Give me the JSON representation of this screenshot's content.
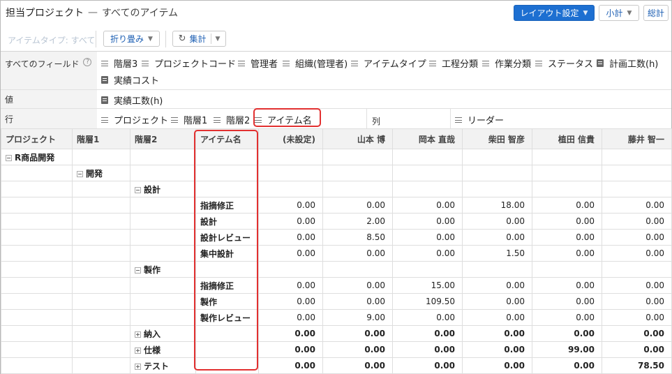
{
  "header": {
    "title": "担当プロジェクト",
    "separator": "—",
    "subtitle": "すべてのアイテム",
    "layout_button": "レイアウト設定",
    "subtotal_button": "小計",
    "total_button": "総計"
  },
  "toolbar": {
    "item_type_filter": "アイテムタイプ: すべて",
    "collapse_button": "折り畳み",
    "aggregate_button": "集計"
  },
  "fields": {
    "all_fields_label": "すべてのフィールド",
    "all_fields_items": [
      "階層3",
      "プロジェクトコード",
      "管理者",
      "組織(管理者)",
      "アイテムタイプ",
      "工程分類",
      "作業分類",
      "ステータス",
      "計画工数(h)",
      "実績コスト"
    ],
    "values_label": "値",
    "values_items": [
      "実績工数(h)"
    ],
    "rows_label": "行",
    "rows_items": [
      "プロジェクト",
      "階層1",
      "階層2",
      "アイテム名"
    ],
    "columns_label": "列",
    "columns_items": [
      "リーダー"
    ]
  },
  "table": {
    "columns": [
      "プロジェクト",
      "階層1",
      "階層2",
      "アイテム名",
      "(未設定)",
      "山本 博",
      "岡本 直哉",
      "柴田 智彦",
      "植田 信貴",
      "藤井 智一"
    ],
    "rows": [
      {
        "project": "R商品開発",
        "l1": "",
        "l2": "",
        "item": "",
        "values": [
          "",
          "",
          "",
          "",
          "",
          ""
        ]
      },
      {
        "project": "",
        "l1": "開発",
        "l2": "",
        "item": "",
        "values": [
          "",
          "",
          "",
          "",
          "",
          ""
        ]
      },
      {
        "project": "",
        "l1": "",
        "l2": "設計",
        "item": "",
        "values": [
          "",
          "",
          "",
          "",
          "",
          ""
        ]
      },
      {
        "project": "",
        "l1": "",
        "l2": "",
        "item": "指摘修正",
        "values": [
          "0.00",
          "0.00",
          "0.00",
          "18.00",
          "0.00",
          "0.00"
        ]
      },
      {
        "project": "",
        "l1": "",
        "l2": "",
        "item": "設計",
        "values": [
          "0.00",
          "2.00",
          "0.00",
          "0.00",
          "0.00",
          "0.00"
        ]
      },
      {
        "project": "",
        "l1": "",
        "l2": "",
        "item": "設計レビュー",
        "values": [
          "0.00",
          "8.50",
          "0.00",
          "0.00",
          "0.00",
          "0.00"
        ]
      },
      {
        "project": "",
        "l1": "",
        "l2": "",
        "item": "集中設計",
        "values": [
          "0.00",
          "0.00",
          "0.00",
          "1.50",
          "0.00",
          "0.00"
        ]
      },
      {
        "project": "",
        "l1": "",
        "l2": "製作",
        "item": "",
        "values": [
          "",
          "",
          "",
          "",
          "",
          ""
        ]
      },
      {
        "project": "",
        "l1": "",
        "l2": "",
        "item": "指摘修正",
        "values": [
          "0.00",
          "0.00",
          "15.00",
          "0.00",
          "0.00",
          "0.00"
        ]
      },
      {
        "project": "",
        "l1": "",
        "l2": "",
        "item": "製作",
        "values": [
          "0.00",
          "0.00",
          "109.50",
          "0.00",
          "0.00",
          "0.00"
        ]
      },
      {
        "project": "",
        "l1": "",
        "l2": "",
        "item": "製作レビュー",
        "values": [
          "0.00",
          "9.00",
          "0.00",
          "0.00",
          "0.00",
          "0.00"
        ]
      },
      {
        "project": "",
        "l1": "",
        "l2": "納入",
        "item": "",
        "values": [
          "0.00",
          "0.00",
          "0.00",
          "0.00",
          "0.00",
          "0.00"
        ]
      },
      {
        "project": "",
        "l1": "",
        "l2": "仕様",
        "item": "",
        "values": [
          "0.00",
          "0.00",
          "0.00",
          "0.00",
          "99.00",
          "0.00"
        ]
      },
      {
        "project": "",
        "l1": "",
        "l2": "テスト",
        "item": "",
        "values": [
          "0.00",
          "0.00",
          "0.00",
          "0.00",
          "0.00",
          "78.50"
        ]
      }
    ]
  },
  "colors": {
    "accent": "#1d6fd1",
    "highlight": "#e23030"
  }
}
